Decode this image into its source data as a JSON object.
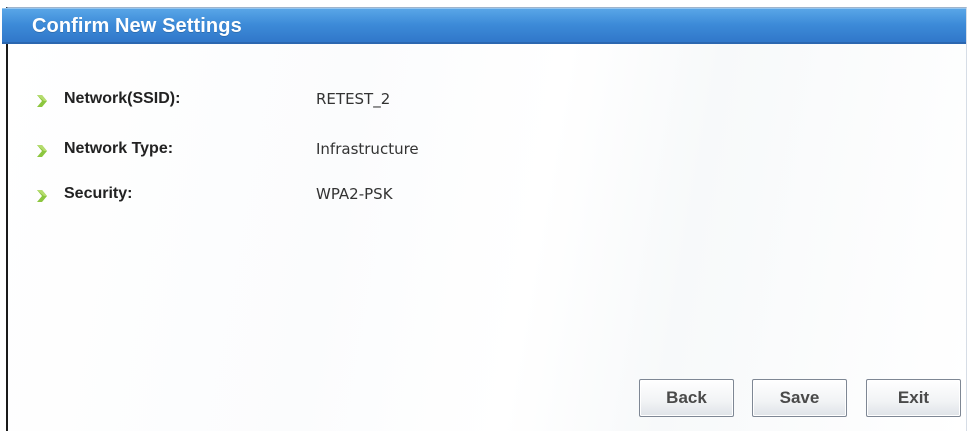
{
  "dialog": {
    "title": "Confirm New Settings",
    "accent_color": "#3d8bd8",
    "bullet_color": "#8cc63f"
  },
  "settings": [
    {
      "label": "Network(SSID):",
      "value": "RETEST_2",
      "icon": "bullet-arrow-icon"
    },
    {
      "label": "Network Type:",
      "value": "Infrastructure",
      "icon": "bullet-arrow-icon"
    },
    {
      "label": "Security:",
      "value": "WPA2-PSK",
      "icon": "bullet-arrow-icon"
    }
  ],
  "buttons": {
    "back": "Back",
    "save": "Save",
    "exit": "Exit"
  }
}
